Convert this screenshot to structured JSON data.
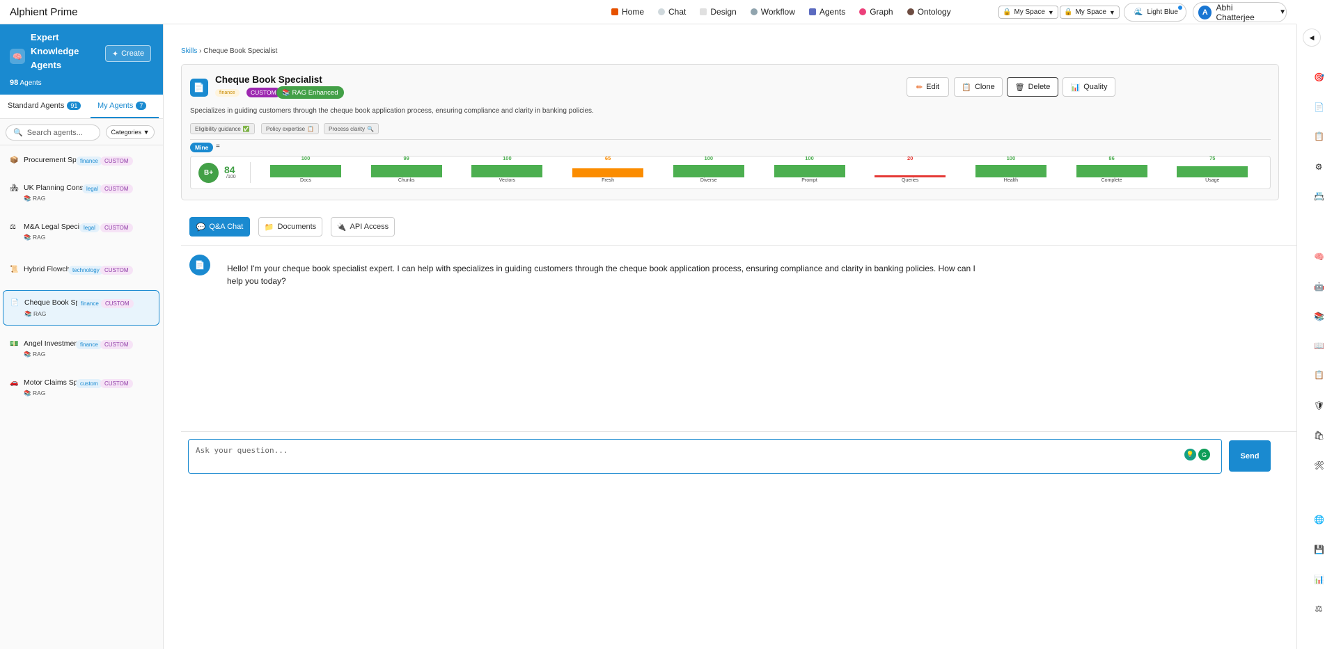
{
  "app": {
    "title": "Alphient Prime"
  },
  "nav": {
    "items": [
      {
        "label": "Home",
        "icon": "home-icon",
        "color": "#e65100"
      },
      {
        "label": "Chat",
        "icon": "chat-icon",
        "color": "#90a4ae"
      },
      {
        "label": "Design",
        "icon": "design-icon",
        "color": "#9e9e9e"
      },
      {
        "label": "Workflow",
        "icon": "workflow-icon",
        "color": "#607d8b"
      },
      {
        "label": "Agents",
        "icon": "agents-icon",
        "color": "#5c6bc0"
      },
      {
        "label": "Graph",
        "icon": "graph-icon",
        "color": "#ec407a"
      },
      {
        "label": "Ontology",
        "icon": "ontology-icon",
        "color": "#6d4c41"
      }
    ],
    "space_1": "My Space",
    "space_2": "My Space",
    "theme": "Light Blue",
    "user_initial": "A",
    "user_name": "Abhi Chatterjee"
  },
  "sidebar": {
    "title": "Expert Knowledge Agents",
    "count": "98",
    "count_label": "Agents",
    "create_label": "Create",
    "tab_standard": "Standard Agents",
    "tab_standard_count": "91",
    "tab_mine": "My Agents",
    "tab_mine_count": "7",
    "search_placeholder": "Search agents...",
    "categories_label": "Categories",
    "agents": [
      {
        "name": "Procurement Speci...",
        "category": "finance",
        "custom": "CUSTOM",
        "rag": "",
        "icon": "box-icon"
      },
      {
        "name": "UK Planning Consult...",
        "category": "legal",
        "custom": "CUSTOM",
        "rag": "RAG",
        "icon": "house-icon"
      },
      {
        "name": "M&A Legal Specialist",
        "category": "legal",
        "custom": "CUSTOM",
        "rag": "RAG",
        "icon": "scales-icon"
      },
      {
        "name": "Hybrid Flowcha...",
        "category": "technology",
        "custom": "CUSTOM",
        "rag": "",
        "icon": "scroll-icon"
      },
      {
        "name": "Cheque Book Spec...",
        "category": "finance",
        "custom": "CUSTOM",
        "rag": "RAG",
        "icon": "document-icon"
      },
      {
        "name": "Angel Investment ...",
        "category": "finance",
        "custom": "CUSTOM",
        "rag": "RAG",
        "icon": "money-icon"
      },
      {
        "name": "Motor Claims Spe...",
        "category": "custom",
        "custom": "CUSTOM",
        "rag": "RAG",
        "icon": "car-icon"
      }
    ]
  },
  "breadcrumb": {
    "root": "Skills",
    "sep": "›",
    "current": "Cheque Book Specialist"
  },
  "agent": {
    "title": "Cheque Book Specialist",
    "category": "finance",
    "custom": "CUSTOM",
    "rag": "RAG Enhanced",
    "description": "Specializes in guiding customers through the cheque book application process, ensuring compliance and clarity in banking policies.",
    "skills": [
      "Eligibility guidance",
      "Policy expertise",
      "Process clarity"
    ],
    "mine": "Mine",
    "eq": "=",
    "actions": {
      "edit": "Edit",
      "clone": "Clone",
      "delete": "Delete",
      "quality": "Quality"
    },
    "score": "84",
    "score_max": "/100",
    "score_grade": "B+",
    "metrics": [
      {
        "label": "Docs",
        "value": 100
      },
      {
        "label": "Chunks",
        "value": 99
      },
      {
        "label": "Vectors",
        "value": 100
      },
      {
        "label": "Fresh",
        "value": 65
      },
      {
        "label": "Diverse",
        "value": 100
      },
      {
        "label": "Prompt",
        "value": 100
      },
      {
        "label": "Queries",
        "value": 20
      },
      {
        "label": "Health",
        "value": 100
      },
      {
        "label": "Complete",
        "value": 86
      },
      {
        "label": "Usage",
        "value": 75
      }
    ],
    "colors": {
      "good": "#4caf50",
      "mid": "#fb8c00",
      "bad": "#e53935"
    }
  },
  "main_tabs": {
    "chat": "Q&A Chat",
    "documents": "Documents",
    "api": "API Access"
  },
  "chat": {
    "welcome": "Hello! I'm your cheque book specialist expert. I can help with specializes in guiding customers through the cheque book application process, ensuring compliance and clarity in banking policies. How can I help you today?",
    "placeholder": "Ask your question...",
    "send": "Send"
  },
  "rail": {
    "collapse": "◀",
    "icons": [
      "target-icon",
      "page-icon",
      "clipboard-icon",
      "gear-icon",
      "card-icon",
      "brain-icon",
      "robot-icon",
      "books-icon",
      "book-icon",
      "notes-icon",
      "shield-icon",
      "bags-icon",
      "tools-icon",
      "globe-icon",
      "floppy-icon",
      "barchart-icon",
      "scales-icon"
    ]
  }
}
